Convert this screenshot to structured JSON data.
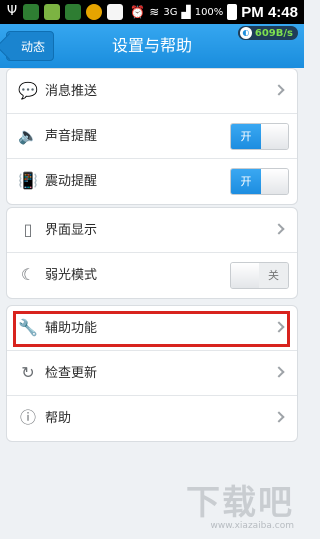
{
  "status_bar": {
    "network": "3G",
    "battery": "100%",
    "time": "PM 4:48"
  },
  "nav": {
    "back_label": "动态",
    "title": "设置与帮助",
    "speed": "609B/s"
  },
  "groups": [
    {
      "rows": [
        {
          "label": "消息推送",
          "icon": "speech-bubble-icon",
          "control": "chevron"
        },
        {
          "label": "声音提醒",
          "icon": "speaker-icon",
          "control": "toggle",
          "state": "开",
          "on": true
        },
        {
          "label": "震动提醒",
          "icon": "vibrate-phone-icon",
          "control": "toggle",
          "state": "开",
          "on": true
        }
      ]
    },
    {
      "rows": [
        {
          "label": "界面显示",
          "icon": "phone-icon",
          "control": "chevron"
        },
        {
          "label": "弱光模式",
          "icon": "moon-icon",
          "control": "toggle",
          "state": "关",
          "on": false
        }
      ]
    },
    {
      "rows": [
        {
          "label": "辅助功能",
          "icon": "wrench-icon",
          "control": "chevron"
        },
        {
          "label": "检查更新",
          "icon": "update-icon",
          "control": "chevron"
        },
        {
          "label": "帮助",
          "icon": "question-icon",
          "control": "chevron"
        }
      ]
    }
  ],
  "colors": {
    "nav_blue": "#1f8fdc",
    "highlight_red": "#d8231e",
    "toggle_on_blue": "#2597e6"
  },
  "watermark": {
    "main": "下载吧",
    "url": "www.xiazaiba.com"
  }
}
